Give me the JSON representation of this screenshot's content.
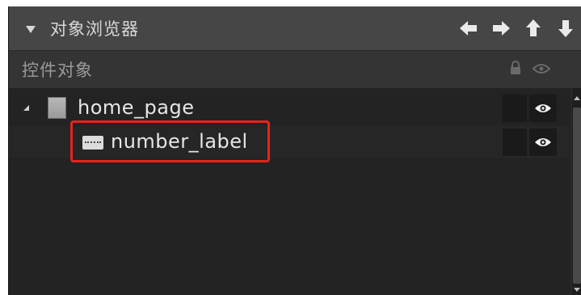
{
  "panel": {
    "title": "对象浏览器",
    "toolbar": [
      {
        "icon": "arrow-left-icon"
      },
      {
        "icon": "arrow-right-icon"
      },
      {
        "icon": "arrow-up-icon"
      },
      {
        "icon": "arrow-down-icon"
      }
    ]
  },
  "subheader": {
    "label": "控件对象",
    "icons": [
      "lock-icon",
      "eye-icon"
    ]
  },
  "tree": {
    "nodes": [
      {
        "label": "home_page",
        "icon": "page-icon",
        "expanded": true,
        "visible": true
      },
      {
        "label": "number_label",
        "icon": "label-widget-icon",
        "visible": true,
        "highlighted": true
      }
    ]
  },
  "colors": {
    "panel_bg": "#232323",
    "titlebar_bg": "#464646",
    "subheader_bg": "#343434",
    "highlight": "#e8231c",
    "text": "#e6e6e6"
  }
}
